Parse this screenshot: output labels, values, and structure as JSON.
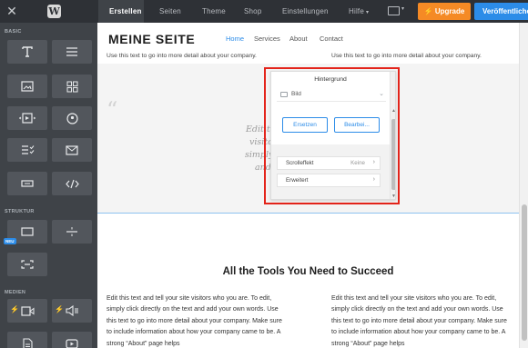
{
  "topbar": {
    "close_glyph": "✕",
    "logo_glyph": "W",
    "tabs": [
      {
        "label": "Erstellen",
        "active": true
      },
      {
        "label": "Seiten",
        "active": false
      },
      {
        "label": "Theme",
        "active": false
      },
      {
        "label": "Shop",
        "active": false
      },
      {
        "label": "Einstellungen",
        "active": false
      },
      {
        "label": "Hilfe",
        "active": false
      }
    ],
    "hilfe_caret": "▾",
    "device_icon": "desktop-icon",
    "upgrade_label": "Upgrade",
    "upgrade_glyph": "⚡",
    "publish_label": "Veröffentlichen",
    "colors": {
      "bar": "#2e3136",
      "upgrade": "#f58a25",
      "publish": "#2c8ce8"
    }
  },
  "sidebar": {
    "sections": [
      {
        "label": "BASIC"
      },
      {
        "label": "STRUKTUR"
      },
      {
        "label": "MEDIEN"
      }
    ],
    "tiles": {
      "basic": [
        "title-icon",
        "text-icon",
        "image-icon",
        "gallery-icon",
        "slideshow-icon",
        "map-icon",
        "form-icon",
        "contact-form-icon",
        "button-icon",
        "embed-code-icon"
      ],
      "struktur": [
        "section-icon",
        "divider-icon",
        "spacer-icon"
      ],
      "medien": [
        "video-icon",
        "audio-icon",
        "document-icon",
        "youtube-icon"
      ]
    },
    "badge": "NEU",
    "bolt_glyph": "⚡"
  },
  "site": {
    "title": "MEINE SEITE",
    "nav": [
      "Home",
      "Services",
      "About",
      "Contact"
    ],
    "intro_line": "Use this text to go into more detail about your company.",
    "quote_glyph": "“",
    "band_lines": [
      "Edit thi",
      "visito",
      "simply",
      "and"
    ],
    "heading": "All the Tools You Need to Succeed",
    "paragraph": "Edit this text and tell your site visitors who you are. To edit, simply click directly on the text and add your own words. Use this text to go into more detail about your company. Make sure to include information about how your company came to be. A strong “About” page helps"
  },
  "popup": {
    "title": "Hintergrund",
    "type_label": "Bild",
    "chevron": "⌄",
    "replace_label": "Ersetzen",
    "edit_label": "Bearbei...",
    "scroll_effect_label": "Scrolleffekt",
    "scroll_effect_value": "Keine",
    "advanced_label": "Erweitert",
    "item_chevron": "›",
    "scroll_up": "▲",
    "scroll_down": "▼",
    "highlight_color": "#e3241b"
  }
}
